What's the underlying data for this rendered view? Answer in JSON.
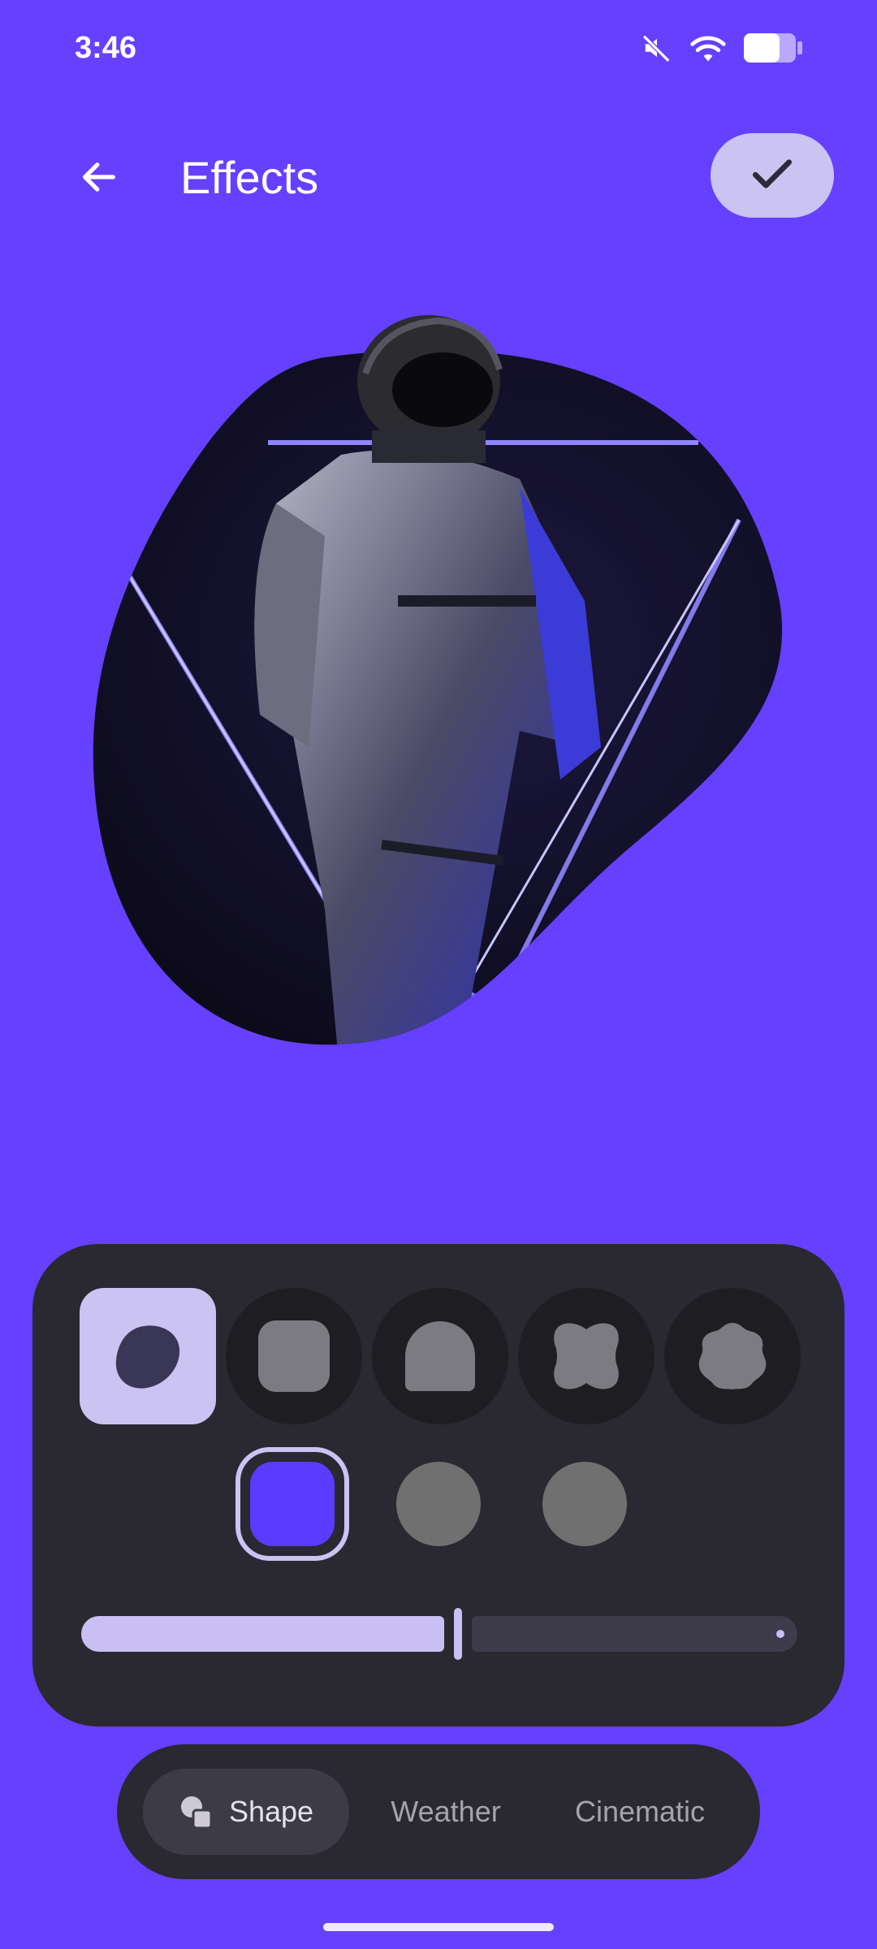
{
  "status_bar": {
    "time": "3:46",
    "icons": [
      "mute-icon",
      "wifi-icon",
      "battery-icon"
    ]
  },
  "header": {
    "back_icon": "arrow-left-icon",
    "title": "Effects",
    "confirm_icon": "check-icon"
  },
  "preview": {
    "image": "astronaut-wallpaper-in-blob-shape"
  },
  "effects_panel": {
    "shapes": [
      {
        "name": "blob",
        "selected": true
      },
      {
        "name": "rounded-square",
        "selected": false
      },
      {
        "name": "arch",
        "selected": false
      },
      {
        "name": "clover",
        "selected": false
      },
      {
        "name": "flower",
        "selected": false
      }
    ],
    "colors": [
      {
        "hex": "#5A3BFF",
        "selected": true
      },
      {
        "hex": "#707070",
        "selected": false
      },
      {
        "hex": "#707070",
        "selected": false
      }
    ],
    "slider_value": 0.52
  },
  "tabs": [
    {
      "label": "Shape",
      "icon": "shapes-icon",
      "active": true
    },
    {
      "label": "Weather",
      "active": false
    },
    {
      "label": "Cinematic",
      "active": false
    }
  ],
  "theme": {
    "background": "#6640FF",
    "panel": "#2A2830",
    "accent": "#CBC3F2"
  }
}
